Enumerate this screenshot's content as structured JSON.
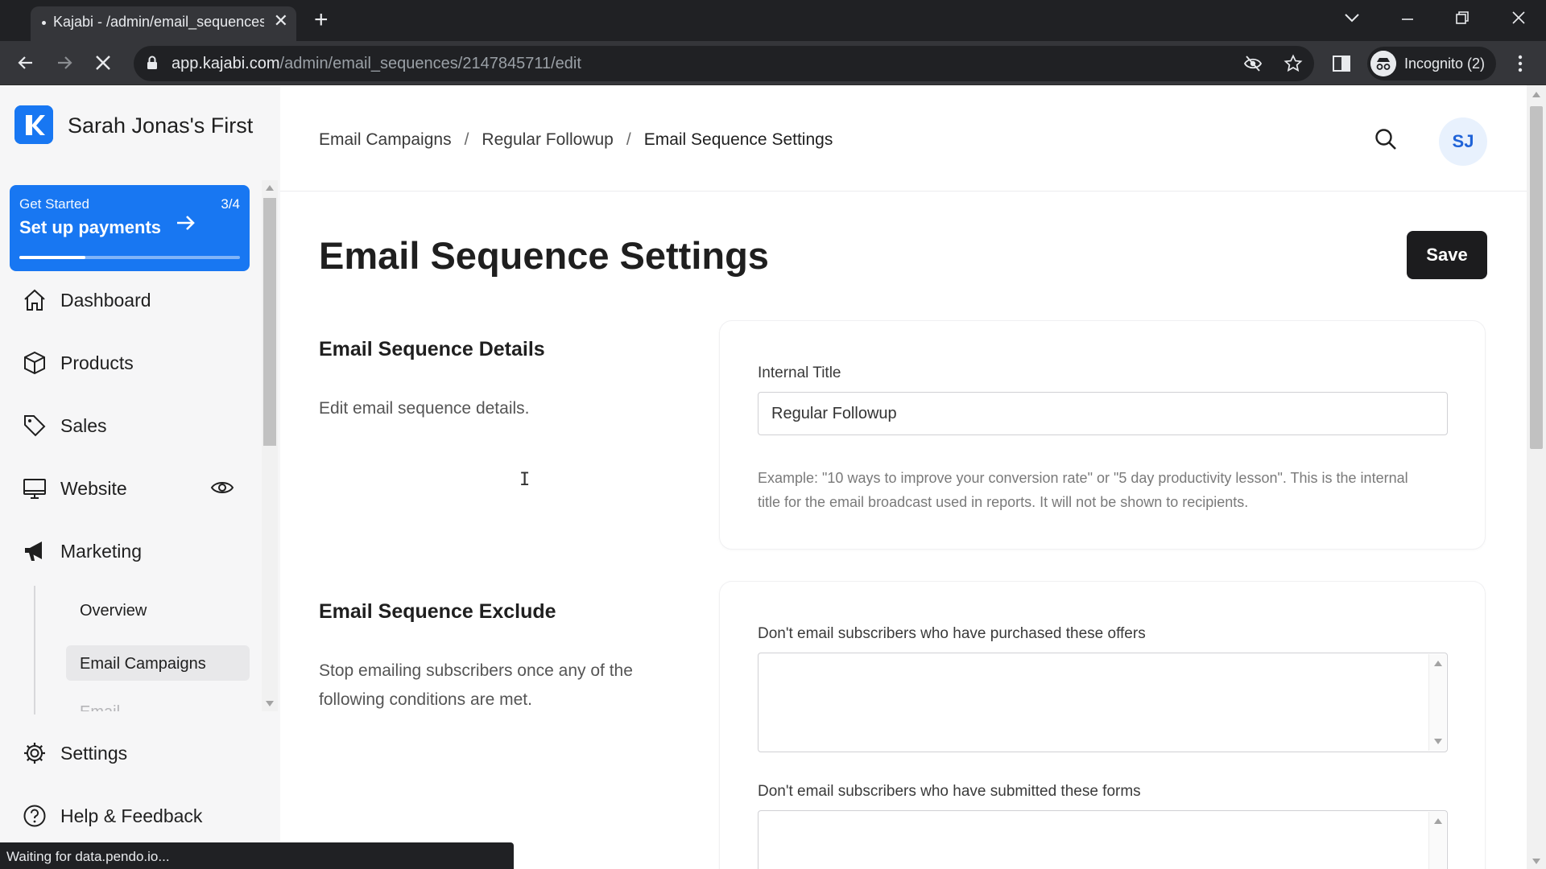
{
  "browser": {
    "tab_title": "Kajabi - /admin/email_sequences",
    "tab_close": "✕",
    "new_tab": "+",
    "url_domain": "app.kajabi.com",
    "url_path": "/admin/email_sequences/2147845711/edit",
    "incognito_label": "Incognito (2)",
    "status_text": "Waiting for data.pendo.io..."
  },
  "sidebar": {
    "site_name": "Sarah Jonas's First",
    "get_started": {
      "label": "Get Started",
      "count": "3/4",
      "title": "Set up payments",
      "progress": 0.3
    },
    "items": [
      {
        "label": "Dashboard",
        "icon": "home-icon"
      },
      {
        "label": "Products",
        "icon": "box-icon"
      },
      {
        "label": "Sales",
        "icon": "tag-icon"
      },
      {
        "label": "Website",
        "icon": "monitor-icon"
      },
      {
        "label": "Marketing",
        "icon": "megaphone-icon"
      },
      {
        "label": "Settings",
        "icon": "gear-icon"
      },
      {
        "label": "Help & Feedback",
        "icon": "help-icon"
      }
    ],
    "marketing_sub": [
      {
        "label": "Overview"
      },
      {
        "label": "Email Campaigns",
        "active": true
      }
    ]
  },
  "header": {
    "breadcrumb": [
      "Email Campaigns",
      "Regular Followup",
      "Email Sequence Settings"
    ],
    "breadcrumb_sep": "/",
    "avatar_initials": "SJ"
  },
  "main": {
    "page_title": "Email Sequence Settings",
    "save_label": "Save",
    "details": {
      "title": "Email Sequence Details",
      "description": "Edit email sequence details.",
      "internal_title_label": "Internal Title",
      "internal_title_value": "Regular Followup",
      "help_text": "Example: \"10 ways to improve your conversion rate\" or \"5 day productivity lesson\". This is the internal title for the email broadcast used in reports. It will not be shown to recipients."
    },
    "exclude": {
      "title": "Email Sequence Exclude",
      "description": "Stop emailing subscribers once any of the following conditions are met.",
      "offers_label": "Don't email subscribers who have purchased these offers",
      "forms_label": "Don't email subscribers who have submitted these forms"
    }
  },
  "colors": {
    "brand_blue": "#1877f2",
    "save_button": "#1c1c1e",
    "chrome_dark": "#202124"
  }
}
